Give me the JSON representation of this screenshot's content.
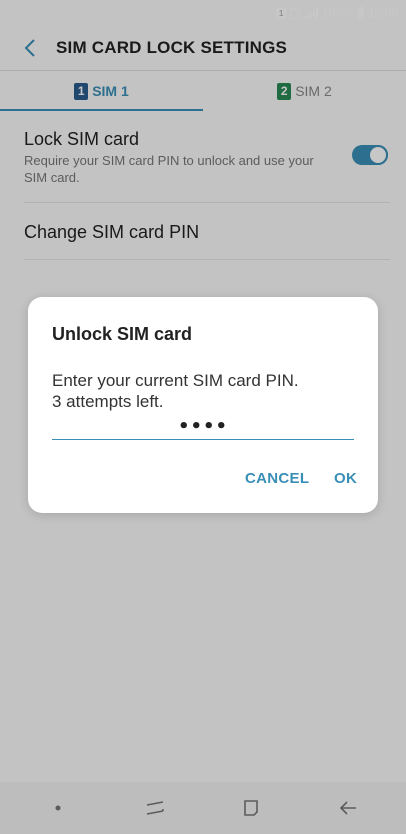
{
  "status_bar": {
    "battery": "100%",
    "time": "10:00",
    "sim_badge": "1"
  },
  "app_bar": {
    "title": "SIM CARD LOCK SETTINGS"
  },
  "tabs": [
    {
      "num": "1",
      "label": "SIM 1",
      "active": true
    },
    {
      "num": "2",
      "label": "SIM 2",
      "active": false
    }
  ],
  "settings": {
    "lock_sim": {
      "title": "Lock SIM card",
      "subtitle": "Require your SIM card PIN to unlock and use your SIM card.",
      "enabled": true
    },
    "change_pin": {
      "title": "Change SIM card PIN"
    }
  },
  "dialog": {
    "title": "Unlock SIM card",
    "message_line1": "Enter your current SIM card PIN.",
    "message_line2": "3 attempts left.",
    "pin_value": "••••",
    "cancel_label": "CANCEL",
    "ok_label": "OK"
  },
  "colors": {
    "accent": "#3a8fb7",
    "sim1": "#2a5d8f",
    "sim2": "#2a8a55"
  },
  "icons": {
    "back": "back-arrow-icon",
    "nav_recents": "recents-icon",
    "nav_home": "home-icon",
    "nav_back": "nav-back-icon"
  }
}
